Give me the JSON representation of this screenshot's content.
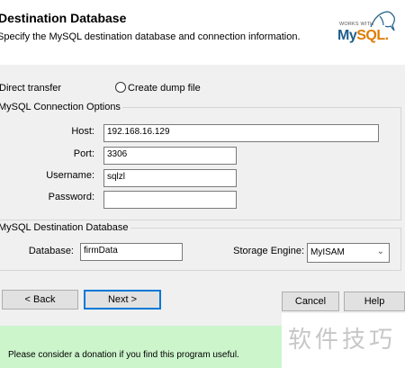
{
  "header": {
    "title": "Destination Database",
    "subtitle": "Specify the MySQL destination database and connection information.",
    "logo": {
      "works_with": "WORKS WITH",
      "mysql_my": "My",
      "mysql_sql": "SQL",
      "mysql_dot": "."
    }
  },
  "transfer_mode": {
    "direct_label": "Direct transfer",
    "dump_label": "Create dump file"
  },
  "connection": {
    "legend": "MySQL Connection Options",
    "host_label": "Host:",
    "host_value": "192.168.16.129",
    "port_label": "Port:",
    "port_value": "3306",
    "username_label": "Username:",
    "username_value": "sqlzl",
    "password_label": "Password:",
    "password_value": ""
  },
  "destination": {
    "legend": "MySQL Destination Database",
    "database_label": "Database:",
    "database_value": "firmData",
    "engine_label": "Storage Engine:",
    "engine_value": "MyISAM"
  },
  "buttons": {
    "back": "< Back",
    "next": "Next >",
    "cancel": "Cancel",
    "help": "Help"
  },
  "footer": {
    "donation_text": "Please consider a donation if you find this program useful.",
    "watermark": "软件技巧"
  },
  "colors": {
    "header_bg": "#ffffff",
    "window_bg": "#f0f0f0",
    "donation_bg": "#ccf5cc",
    "default_button_border": "#0078d7"
  }
}
